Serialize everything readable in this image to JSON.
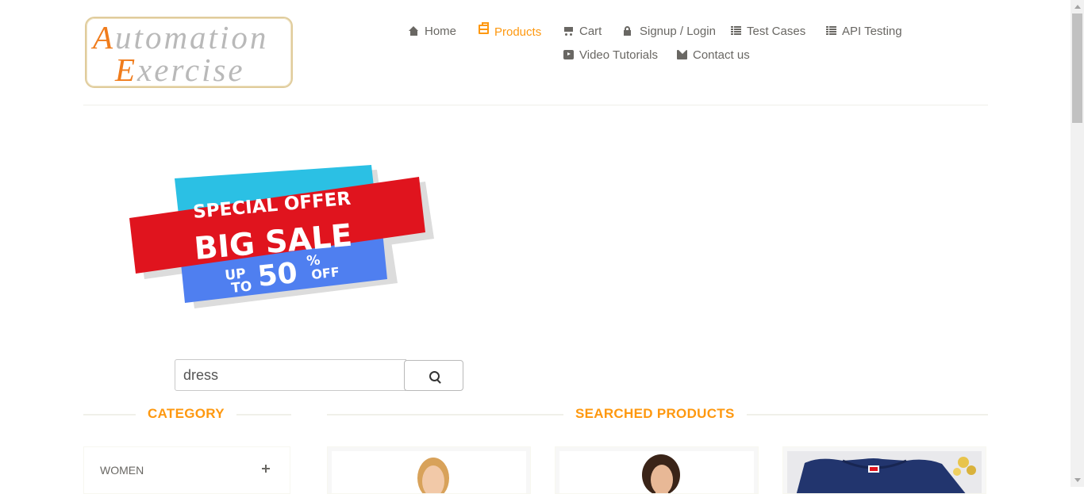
{
  "brand": {
    "line1_cap": "A",
    "line1_rest": "utomation",
    "line2_cap": "E",
    "line2_rest": "xercise",
    "accent_color": "#f07c1c",
    "text_color": "#b9b9b9"
  },
  "nav": {
    "items": [
      {
        "label": "Home",
        "icon": "home-icon"
      },
      {
        "label": "Products",
        "icon": "products-icon",
        "active": true
      },
      {
        "label": "Cart",
        "icon": "cart-icon"
      },
      {
        "label": "Signup / Login",
        "icon": "lock-icon"
      },
      {
        "label": "Test Cases",
        "icon": "list-icon"
      },
      {
        "label": "API Testing",
        "icon": "list-icon"
      },
      {
        "label": "Video Tutorials",
        "icon": "youtube-icon"
      },
      {
        "label": "Contact us",
        "icon": "envelope-icon"
      }
    ],
    "active_color": "#fe980f"
  },
  "banner": {
    "line1": "SPECIAL OFFER",
    "line2": "BIG SALE",
    "up": "UP",
    "to": "TO",
    "percent": "50",
    "percent_sign": "%",
    "off": "OFF"
  },
  "search": {
    "value": "dress",
    "button_icon": "search-icon"
  },
  "sidebar": {
    "title": "CATEGORY",
    "categories": [
      {
        "label": "WOMEN",
        "icon": "plus-icon"
      }
    ]
  },
  "main": {
    "title": "SEARCHED PRODUCTS"
  },
  "colors": {
    "accent": "#fe980f",
    "text": "#696763",
    "banner_cyan": "#2bc0e4",
    "banner_red": "#e0141e",
    "banner_blue": "#4f7ff0"
  }
}
